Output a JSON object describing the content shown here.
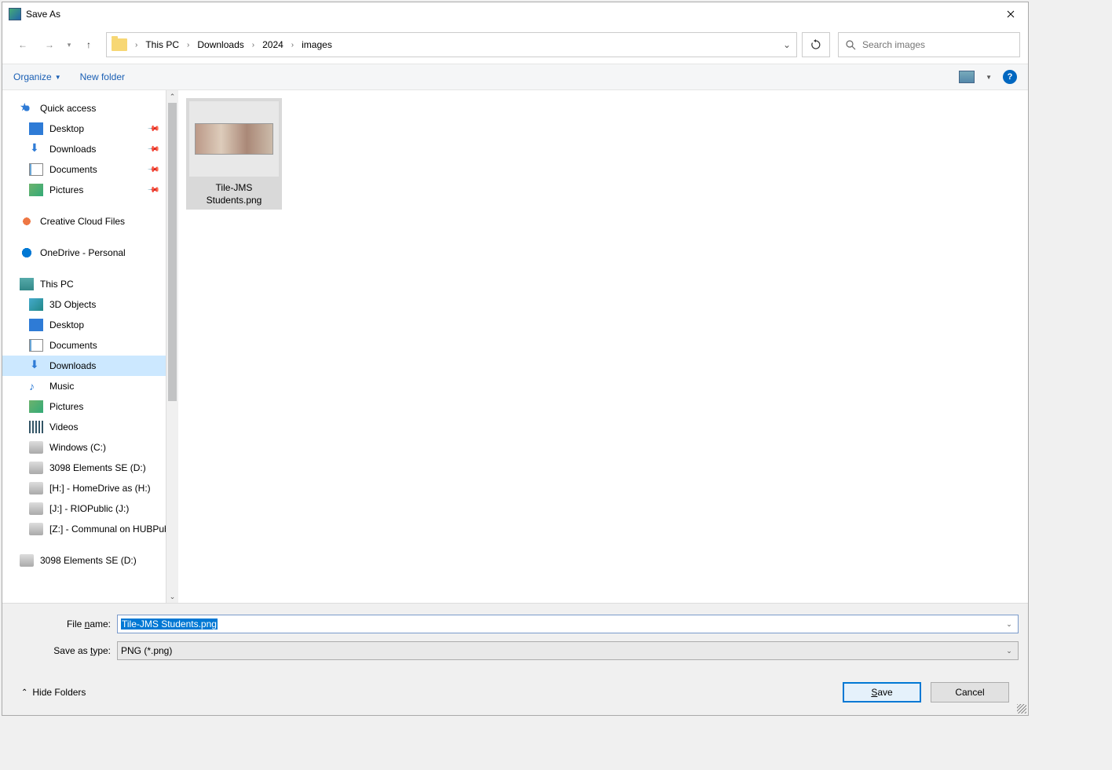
{
  "window": {
    "title": "Save As"
  },
  "breadcrumb": {
    "items": [
      "This PC",
      "Downloads",
      "2024",
      "images"
    ]
  },
  "search": {
    "placeholder": "Search images"
  },
  "toolbar": {
    "organize": "Organize",
    "new_folder": "New folder"
  },
  "sidebar": {
    "quick_access": {
      "label": "Quick access"
    },
    "quick_items": [
      {
        "label": "Desktop",
        "pinned": true,
        "icon": "ico-desktop"
      },
      {
        "label": "Downloads",
        "pinned": true,
        "icon": "ico-dl"
      },
      {
        "label": "Documents",
        "pinned": true,
        "icon": "ico-doc"
      },
      {
        "label": "Pictures",
        "pinned": true,
        "icon": "ico-pic"
      }
    ],
    "creative": {
      "label": "Creative Cloud Files"
    },
    "onedrive": {
      "label": "OneDrive - Personal"
    },
    "this_pc": {
      "label": "This PC"
    },
    "pc_items": [
      {
        "label": "3D Objects",
        "icon": "ico-3d"
      },
      {
        "label": "Desktop",
        "icon": "ico-desktop"
      },
      {
        "label": "Documents",
        "icon": "ico-doc"
      },
      {
        "label": "Downloads",
        "icon": "ico-dl",
        "selected": true
      },
      {
        "label": "Music",
        "icon": "ico-music"
      },
      {
        "label": "Pictures",
        "icon": "ico-pic"
      },
      {
        "label": "Videos",
        "icon": "ico-video"
      },
      {
        "label": "Windows (C:)",
        "icon": "ico-drive"
      },
      {
        "label": "3098 Elements SE (D:)",
        "icon": "ico-drive"
      },
      {
        "label": "[H:] - HomeDrive as (H:)",
        "icon": "ico-drive"
      },
      {
        "label": "[J:] - RIOPublic (J:)",
        "icon": "ico-drive"
      },
      {
        "label": "[Z:] - Communal on HUBPublic",
        "icon": "ico-drive"
      }
    ],
    "extra_drive": {
      "label": "3098 Elements SE (D:)"
    }
  },
  "files": [
    {
      "name": "Tile-JMS Students.png"
    }
  ],
  "form": {
    "filename_label": "File name:",
    "filename_value": "Tile-JMS Students.png",
    "filetype_label": "Save as type:",
    "filetype_value": "PNG (*.png)"
  },
  "footer": {
    "hide_folders": "Hide Folders",
    "save": "Save",
    "cancel": "Cancel"
  }
}
